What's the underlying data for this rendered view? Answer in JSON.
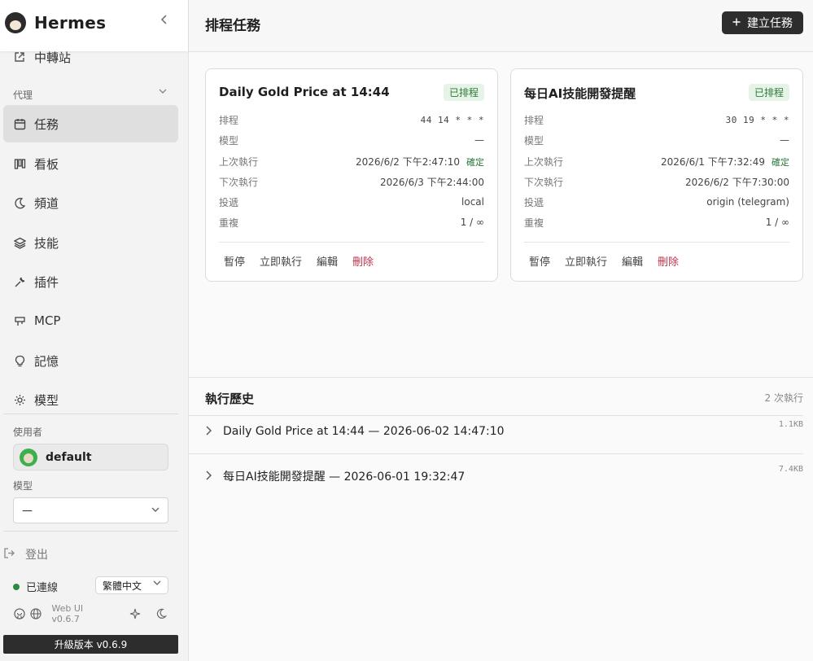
{
  "app": {
    "name": "Hermes"
  },
  "sidebar": {
    "relay_label": "中轉站",
    "section_label": "代理",
    "items": [
      {
        "label": "任務",
        "icon": "calendar-icon"
      },
      {
        "label": "看板",
        "icon": "kanban-icon"
      },
      {
        "label": "頻道",
        "icon": "moon-icon"
      },
      {
        "label": "技能",
        "icon": "layers-icon"
      },
      {
        "label": "插件",
        "icon": "wrench-icon"
      },
      {
        "label": "MCP",
        "icon": "plug-icon"
      },
      {
        "label": "記憶",
        "icon": "lightbulb-icon"
      },
      {
        "label": "模型",
        "icon": "sun-icon"
      }
    ],
    "user_label": "使用者",
    "user_name": "default",
    "model_label": "模型",
    "model_value": "—",
    "logout_label": "登出",
    "status_label": "已連線",
    "language": "繁體中文",
    "version": "Web UI v0.6.7",
    "upgrade_label": "升級版本 v0.6.9"
  },
  "header": {
    "title": "排程任務",
    "create_label": "建立任務"
  },
  "cards": [
    {
      "title": "Daily Gold Price at 14:44",
      "badge": "已排程",
      "rows": [
        {
          "key": "排程",
          "value": "44 14 * * *"
        },
        {
          "key": "模型",
          "value": "—"
        },
        {
          "key": "上次執行",
          "value": "2026/6/2 下午2:47:10",
          "status": "確定"
        },
        {
          "key": "下次執行",
          "value": "2026/6/3 下午2:44:00"
        },
        {
          "key": "投遞",
          "value": "local"
        },
        {
          "key": "重複",
          "value": "1 / ∞"
        }
      ],
      "actions": {
        "pause": "暫停",
        "run_now": "立即執行",
        "edit": "編輯",
        "delete": "刪除"
      }
    },
    {
      "title": "每日AI技能開發提醒",
      "badge": "已排程",
      "rows": [
        {
          "key": "排程",
          "value": "30 19 * * *"
        },
        {
          "key": "模型",
          "value": "—"
        },
        {
          "key": "上次執行",
          "value": "2026/6/1 下午7:32:49",
          "status": "確定"
        },
        {
          "key": "下次執行",
          "value": "2026/6/2 下午7:30:00"
        },
        {
          "key": "投遞",
          "value": "origin (telegram)"
        },
        {
          "key": "重複",
          "value": "1 / ∞"
        }
      ],
      "actions": {
        "pause": "暫停",
        "run_now": "立即執行",
        "edit": "編輯",
        "delete": "刪除"
      }
    }
  ],
  "history": {
    "title": "執行歷史",
    "count": "2 次執行",
    "items": [
      {
        "text": "Daily Gold Price at 14:44 — 2026-06-02 14:47:10",
        "size": "1.1KB"
      },
      {
        "text": "每日AI技能開發提醒 — 2026-06-01 19:32:47",
        "size": "7.4KB"
      }
    ]
  },
  "colors": {
    "accent_dark": "#2d2d2d",
    "success": "#2c7a3a",
    "danger": "#c0344d",
    "status_dot": "#2e8b3e"
  }
}
